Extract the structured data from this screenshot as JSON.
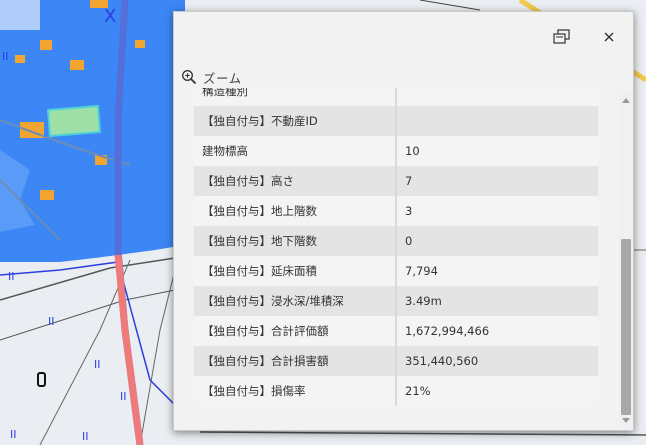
{
  "popup": {
    "zoom_label": "ズーム",
    "icons": {
      "restore": "restore-window-icon",
      "close": "close-icon",
      "zoom": "zoom-in-icon"
    }
  },
  "attributes": [
    {
      "key": "構造種別",
      "value": ""
    },
    {
      "key": "【独自付与】不動産ID",
      "value": ""
    },
    {
      "key": "建物標高",
      "value": "10"
    },
    {
      "key": "【独自付与】高さ",
      "value": "7"
    },
    {
      "key": "【独自付与】地上階数",
      "value": "3"
    },
    {
      "key": "【独自付与】地下階数",
      "value": "0"
    },
    {
      "key": "【独自付与】延床面積",
      "value": "7,794"
    },
    {
      "key": "【独自付与】浸水深/堆積深",
      "value": "3.49m"
    },
    {
      "key": "【独自付与】合計評価額",
      "value": "1,672,994,466"
    },
    {
      "key": "【独自付与】合計損害額",
      "value": "351,440,560"
    },
    {
      "key": "【独自付与】損傷率",
      "value": "21%"
    }
  ],
  "map": {
    "map_label": "X",
    "colors": {
      "flood": "#3d86f5",
      "railway": "#f07a7a",
      "background": "#eaeef2",
      "building": "#f2a531"
    }
  }
}
